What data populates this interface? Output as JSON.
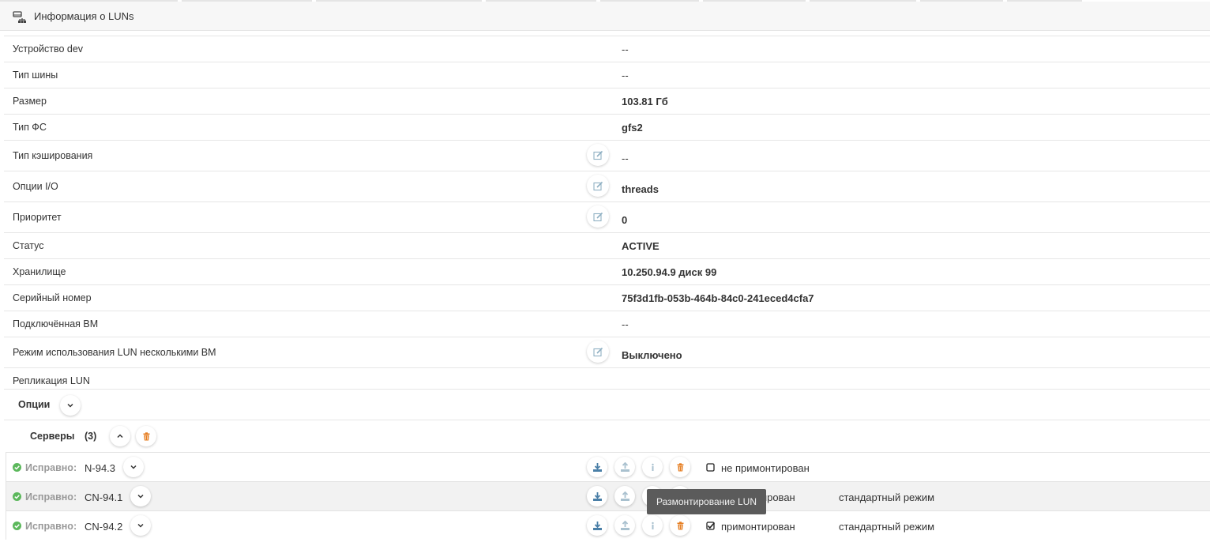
{
  "header": {
    "title": "Информация о LUNs",
    "icon": "storage-network-icon"
  },
  "properties": [
    {
      "label": "Устройство dev",
      "value": "--",
      "bold": false,
      "editable": false
    },
    {
      "label": "Тип шины",
      "value": "--",
      "bold": false,
      "editable": false
    },
    {
      "label": "Размер",
      "value": "103.81 Гб",
      "bold": true,
      "editable": false
    },
    {
      "label": "Тип ФС",
      "value": "gfs2",
      "bold": true,
      "editable": false
    },
    {
      "label": "Тип кэширования",
      "value": "--",
      "bold": false,
      "editable": true
    },
    {
      "label": "Опции I/O",
      "value": "threads",
      "bold": true,
      "editable": true
    },
    {
      "label": "Приоритет",
      "value": "0",
      "bold": true,
      "editable": true
    },
    {
      "label": "Статус",
      "value": "ACTIVE",
      "bold": true,
      "editable": false
    },
    {
      "label": "Хранилище",
      "value": "10.250.94.9 диск 99",
      "bold": true,
      "editable": false
    },
    {
      "label": "Серийный номер",
      "value": "75f3d1fb-053b-464b-84c0-241eced4cfa7",
      "bold": true,
      "editable": false
    },
    {
      "label": "Подключённая ВМ",
      "value": "--",
      "bold": false,
      "editable": false
    },
    {
      "label": "Режим использования LUN несколькими ВМ",
      "value": "Выключено",
      "bold": true,
      "editable": true
    },
    {
      "label": "Репликация LUN",
      "value": "",
      "bold": false,
      "editable": false
    }
  ],
  "options": {
    "label": "Опции"
  },
  "servers": {
    "label": "Серверы",
    "count": "(3)",
    "rows": [
      {
        "status": "Исправно:",
        "name": "N-94.3",
        "mounted": false,
        "mount_state": "не примонтирован",
        "mode": ""
      },
      {
        "status": "Исправно:",
        "name": "CN-94.1",
        "mounted": true,
        "mount_state": "примонтирован",
        "mode": "стандартный режим"
      },
      {
        "status": "Исправно:",
        "name": "CN-94.2",
        "mounted": true,
        "mount_state": "примонтирован",
        "mode": "стандартный режим"
      }
    ]
  },
  "tooltip": {
    "text": "Размонтирование LUN"
  },
  "colors": {
    "ok": "#5cb85c",
    "danger": "#e67e22",
    "action": "#4a7fa7",
    "action_muted": "#a9c1cf"
  }
}
